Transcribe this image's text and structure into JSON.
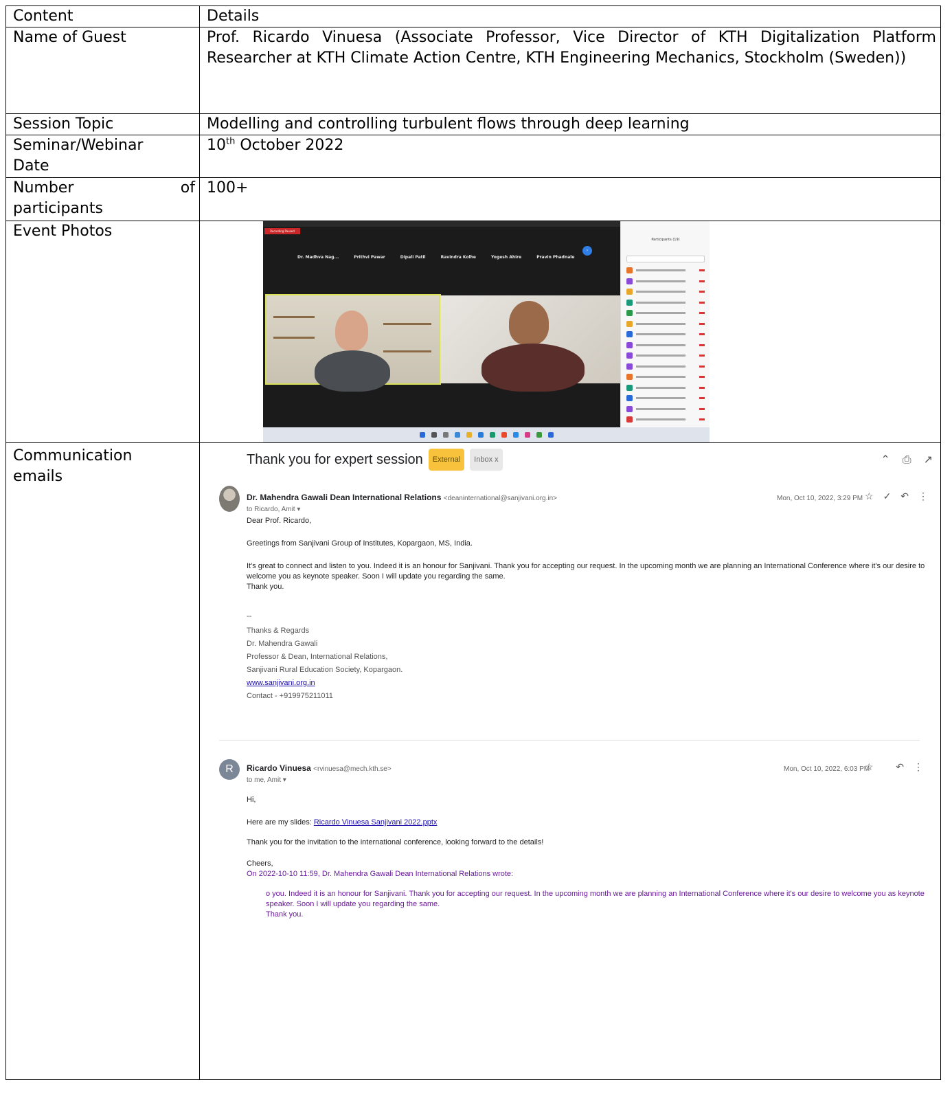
{
  "table": {
    "header": {
      "col1": "Content",
      "col2": "Details"
    },
    "guest_label": "Name of Guest",
    "guest_value": "Prof. Ricardo Vinuesa (Associate Professor, Vice Director of KTH Digitalization Platform Researcher at KTH Climate Action Centre, KTH Engineering Mechanics, Stockholm (Sweden))",
    "topic_label": "Session Topic",
    "topic_value": "Modelling and controlling turbulent flows through deep learning",
    "date_label_line1": "Seminar/Webinar",
    "date_label_line2": "Date",
    "date_day": "10",
    "date_suffix": "th",
    "date_rest": " October 2022",
    "participants_label_word1": "Number",
    "participants_label_word2": "of",
    "participants_label_line2": "participants",
    "participants_value": "100+",
    "photos_label": "Event Photos",
    "emails_label_line1": "Communication",
    "emails_label_line2": "emails"
  },
  "zoom": {
    "recording": "Recording Paused",
    "participant_names": [
      "Dr. Madhva Nag...",
      "Prithvi Pawar",
      "Dipali Patil",
      "Ravindra Kolhe",
      "Yogesh Ahire",
      "Pravin Phadnale"
    ],
    "panel_title": "Participants (19)"
  },
  "email": {
    "subject": "Thank you for expert session",
    "tag_external": "External",
    "tag_inbox": "Inbox x",
    "msg1": {
      "sender": "Dr. Mahendra Gawali Dean International Relations",
      "address": "<deaninternational@sanjivani.org.in>",
      "to": "to Ricardo, Amit ▾",
      "date": "Mon, Oct 10, 2022, 3:29 PM",
      "greeting": "Dear Prof. Ricardo,",
      "line1": "Greetings from Sanjivani  Group of Institutes, Kopargaon, MS, India.",
      "line2": "It's great to connect and listen to you. Indeed it is an honour for Sanjivani. Thank you for accepting our request. In the upcoming month we are planning an International Conference where it's our desire to welcome you as keynote speaker. Soon I will update you regarding the same.",
      "line3": "Thank you.",
      "dash": "--",
      "sig1": "Thanks & Regards",
      "sig2": "Dr. Mahendra Gawali",
      "sig3": "Professor & Dean, International Relations,",
      "sig4": "Sanjivani Rural Education Society, Kopargaon.",
      "sig_link": "www.sanjivani.org.in",
      "sig_contact": "Contact - +919975211011"
    },
    "msg2": {
      "avatar_letter": "R",
      "sender": "Ricardo Vinuesa",
      "address": "<rvinuesa@mech.kth.se>",
      "to": "to me, Amit ▾",
      "date": "Mon, Oct 10, 2022, 6:03 PM",
      "hi": "Hi,",
      "slides_prefix": "Here are my slides: ",
      "slides_link": "Ricardo Vinuesa Sanjivani 2022.pptx",
      "thanks": "Thank you for the invitation to the international conference, looking forward to the details!",
      "cheers": "Cheers,",
      "quote_header": "On 2022-10-10 11:59, Dr. Mahendra Gawali Dean International Relations wrote:",
      "quote_body": "o you. Indeed it is an honour for Sanjivani. Thank you for accepting our request. In the upcoming month we are planning an International Conference where it's our desire to welcome you as keynote speaker. Soon I will update you regarding the same.",
      "quote_thanks": "Thank you."
    }
  },
  "colors": {
    "zoom_bg": "#1b1b1b",
    "active_speaker_border": "#d8e05a",
    "external_tag": "#f9c23c",
    "link": "#1a0dab",
    "quote": "#6a1b9a"
  }
}
